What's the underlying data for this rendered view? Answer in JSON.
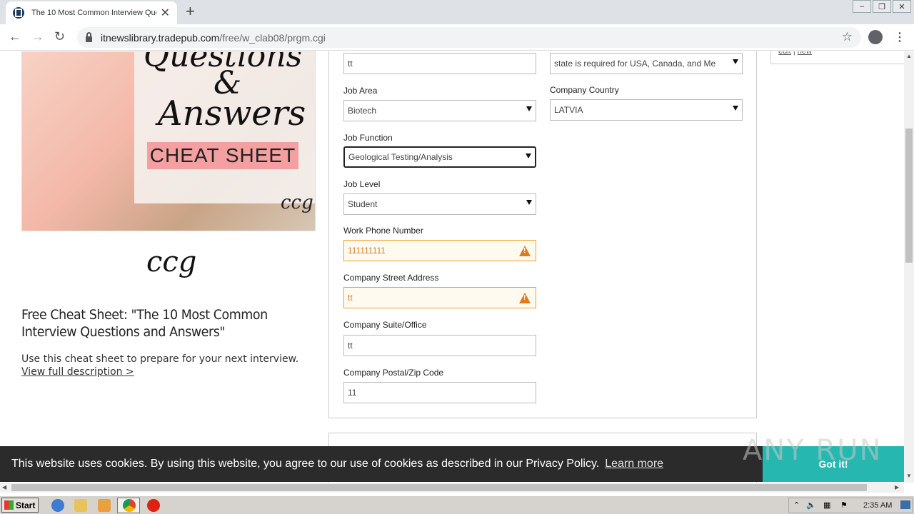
{
  "browser": {
    "tab_title": "The 10 Most Common Interview Que",
    "url_host": "itnewslibrary.tradepub.com",
    "url_path": "/free/w_clab08/prgm.cgi",
    "new_tab": "+",
    "close_tab": "✕"
  },
  "hero": {
    "line1": "Questions",
    "line2": "&",
    "line3": "Answers",
    "badge": "CHEAT SHEET",
    "mark": "ccg"
  },
  "brand_logo": "ccg",
  "asset": {
    "title": "Free Cheat Sheet: \"The 10 Most Common Interview Questions and Answers\"",
    "description": "Use this cheat sheet to prepare for your next interview.",
    "link": "View full description >"
  },
  "form": {
    "top_left_value": "tt",
    "state_value": "state is required for USA, Canada, and Me",
    "job_area_label": "Job Area",
    "job_area_value": "Biotech",
    "company_country_label": "Company Country",
    "company_country_value": "LATVIA",
    "job_function_label": "Job Function",
    "job_function_value": "Geological Testing/Analysis",
    "job_level_label": "Job Level",
    "job_level_value": "Student",
    "work_phone_label": "Work Phone Number",
    "work_phone_value": "111111111",
    "street_label": "Company Street Address",
    "street_value": "tt",
    "suite_label": "Company Suite/Office",
    "suite_value": "tt",
    "postal_label": "Company Postal/Zip Code",
    "postal_value": "11"
  },
  "side": {
    "edit": "edit",
    "sep": "|",
    "new": "new"
  },
  "cookie": {
    "text": "This website uses cookies. By using this website, you agree to our use of cookies as described in our Privacy Policy.",
    "learn_more": "Learn more",
    "got_it": "Got it!"
  },
  "watermark": "ANY RUN",
  "taskbar": {
    "start": "Start",
    "clock": "2:35 AM"
  },
  "colors": {
    "accent_teal": "#26b7b0",
    "warning_orange": "#e07a1f",
    "cookie_bg": "#2b2b2b"
  }
}
